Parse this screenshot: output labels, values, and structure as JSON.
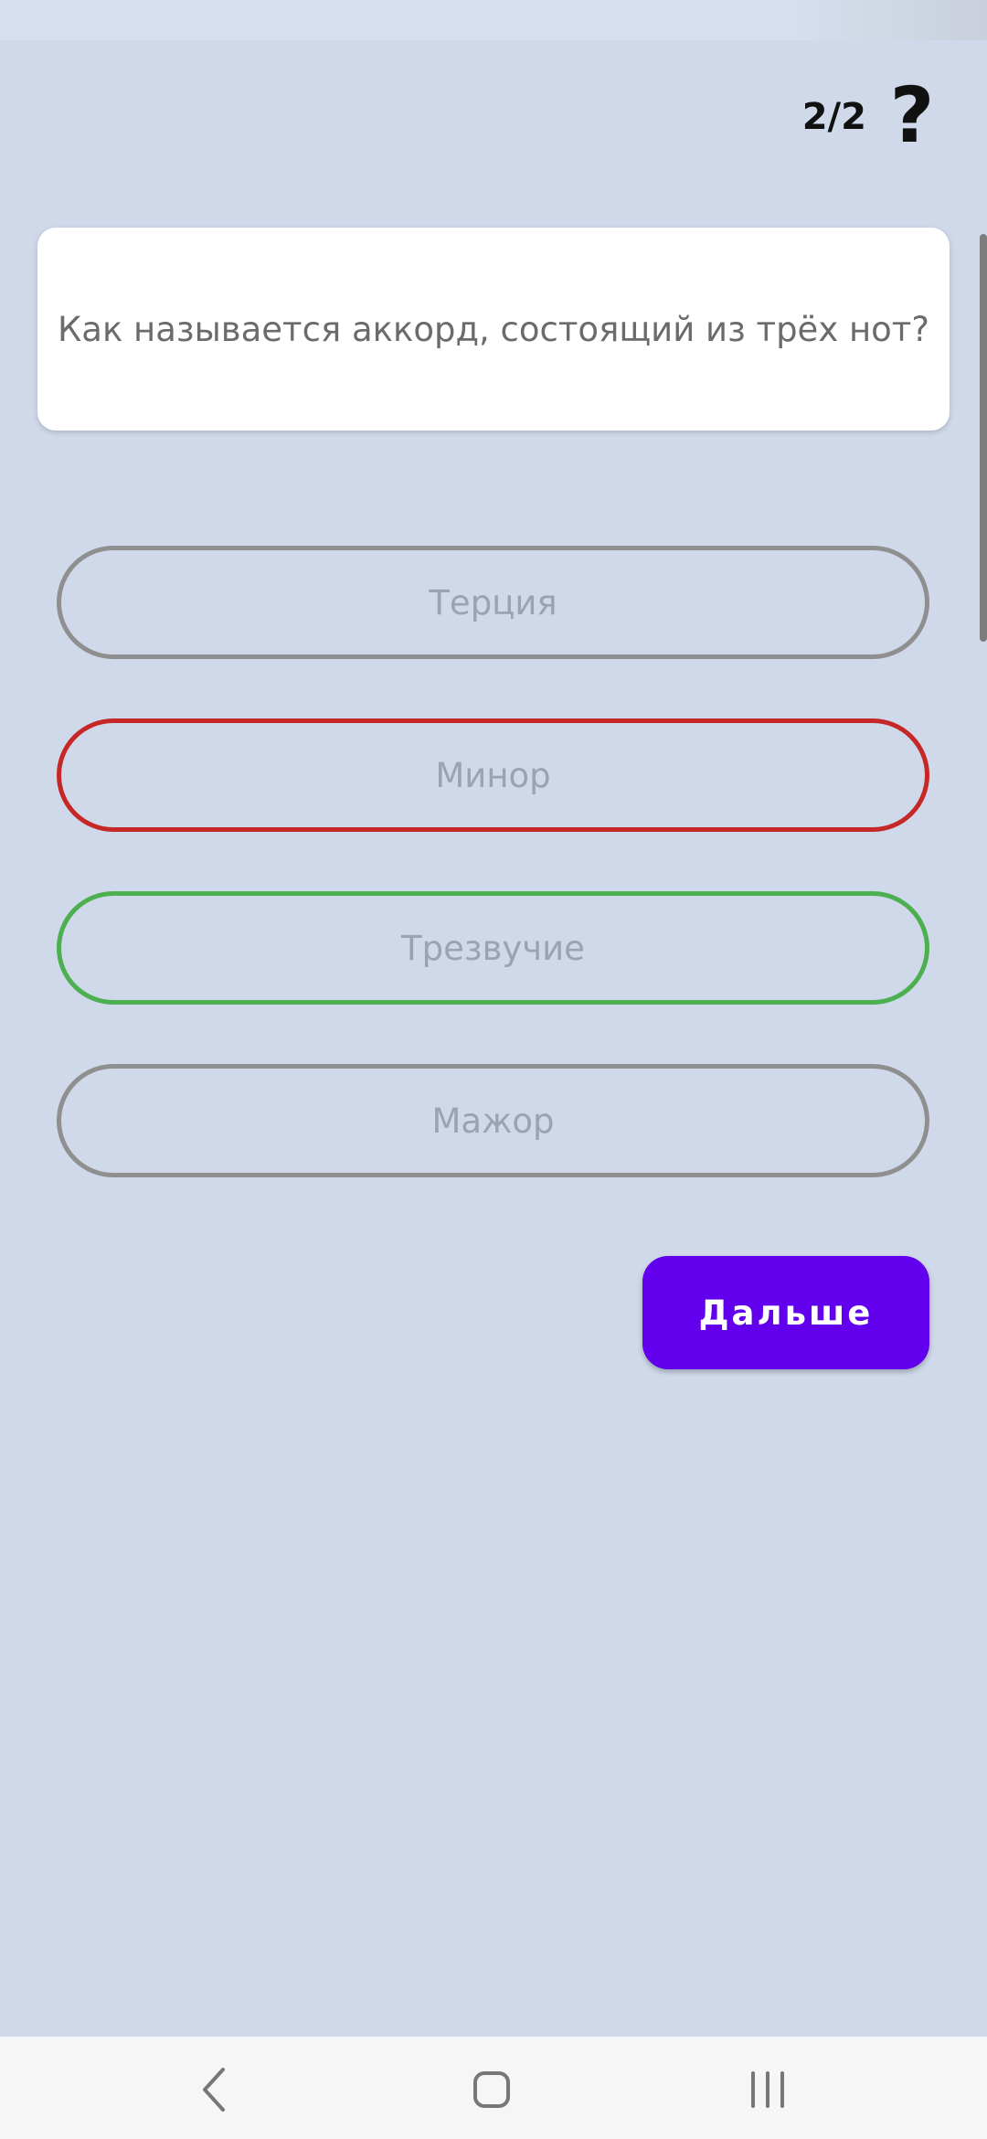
{
  "header": {
    "counter": "2/2",
    "help_symbol": "?"
  },
  "question": {
    "text": "Как называется аккорд, состоящий из трёх нот?"
  },
  "answers": [
    {
      "label": "Терция",
      "state": "neutral"
    },
    {
      "label": "Минор",
      "state": "wrong"
    },
    {
      "label": "Трезвучие",
      "state": "correct"
    },
    {
      "label": "Мажор",
      "state": "neutral"
    }
  ],
  "next_button": {
    "label": "Дальше"
  },
  "colors": {
    "background": "#cfd9ea",
    "accent": "#6200ee",
    "wrong": "#c62828",
    "correct": "#4caf50",
    "neutral_border": "#8f8f8f"
  },
  "nav": {
    "back_icon": "chevron-left-icon",
    "home_icon": "rounded-square-home-icon",
    "recents_icon": "three-bars-recents-icon"
  }
}
